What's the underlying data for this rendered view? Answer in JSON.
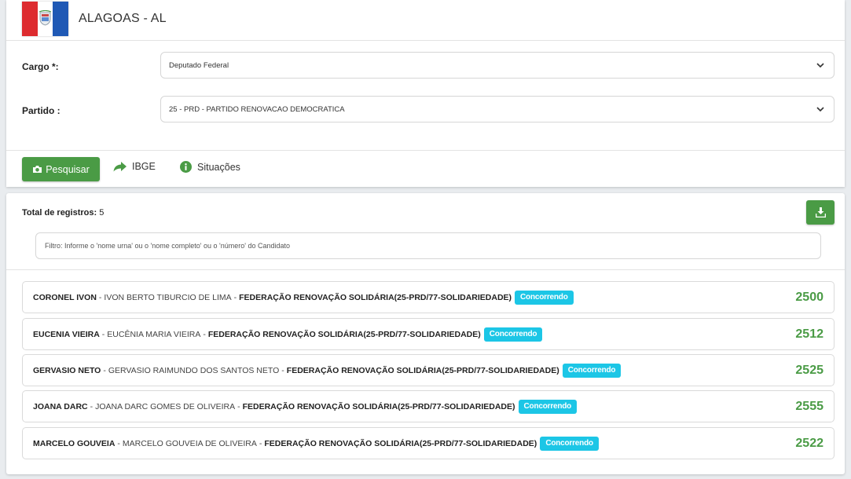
{
  "header": {
    "state_title": "ALAGOAS - AL",
    "flag_colors": [
      "#dd2b2f",
      "#ffffff",
      "#1f59b5"
    ]
  },
  "form": {
    "cargo_label": "Cargo *:",
    "cargo_value": "Deputado Federal",
    "partido_label": "Partido :",
    "partido_value": "25 - PRD - PARTIDO RENOVACAO DEMOCRATICA"
  },
  "toolbar": {
    "search_label": "Pesquisar",
    "search_icon": "camera-icon",
    "ibge_label": "IBGE",
    "ibge_icon": "share-arrow-icon",
    "situacoes_label": "Situações",
    "situacoes_icon": "info-circle-icon"
  },
  "results": {
    "total_label": "Total de registros:",
    "total_value": "5",
    "download_icon": "download-icon",
    "filter_placeholder": "Filtro: Informe o 'nome urna' ou o 'nome completo' ou o 'número' do Candidato",
    "separator": "-",
    "candidates": [
      {
        "nick": "CORONEL IVON",
        "full_name": "IVON BERTO TIBURCIO DE LIMA",
        "party": "FEDERAÇÃO RENOVAÇÃO SOLIDÁRIA(25-PRD/77-SOLIDARIEDADE)",
        "status": "Concorrendo",
        "number": "2500"
      },
      {
        "nick": "EUCENIA VIEIRA",
        "full_name": "EUCÊNIA MARIA VIEIRA",
        "party": "FEDERAÇÃO RENOVAÇÃO SOLIDÁRIA(25-PRD/77-SOLIDARIEDADE)",
        "status": "Concorrendo",
        "number": "2512"
      },
      {
        "nick": "GERVASIO NETO",
        "full_name": "GERVASIO RAIMUNDO DOS SANTOS NETO",
        "party": "FEDERAÇÃO RENOVAÇÃO SOLIDÁRIA(25-PRD/77-SOLIDARIEDADE)",
        "status": "Concorrendo",
        "number": "2525"
      },
      {
        "nick": "JOANA DARC",
        "full_name": "JOANA DARC GOMES DE OLIVEIRA",
        "party": "FEDERAÇÃO RENOVAÇÃO SOLIDÁRIA(25-PRD/77-SOLIDARIEDADE)",
        "status": "Concorrendo",
        "number": "2555"
      },
      {
        "nick": "MARCELO GOUVEIA",
        "full_name": "MARCELO GOUVEIA DE OLIVEIRA",
        "party": "FEDERAÇÃO RENOVAÇÃO SOLIDÁRIA(25-PRD/77-SOLIDARIEDADE)",
        "status": "Concorrendo",
        "number": "2522"
      }
    ]
  },
  "colors": {
    "primary_green": "#4a9b45",
    "badge_cyan": "#1cc6e6"
  }
}
